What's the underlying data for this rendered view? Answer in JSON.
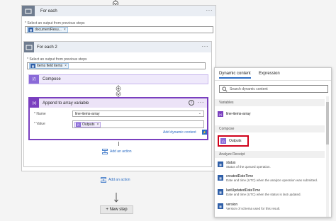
{
  "canvas": {
    "add_action_label": "Add an action",
    "new_step_label": "+ New step"
  },
  "foreach_outer": {
    "title": "For each",
    "select_label": "* Select an output from previous steps",
    "token": "documentResu..."
  },
  "foreach_inner": {
    "title": "For each 2",
    "select_label": "* Select an output from previous steps",
    "token": "Items field items",
    "add_action_label": "Add an action"
  },
  "compose": {
    "title": "Compose"
  },
  "append_action": {
    "title": "Append to array variable",
    "name_label": "* Name",
    "name_value": "line-items-array",
    "value_label": "* Value",
    "value_token": "Outputs",
    "add_dynamic": "Add dynamic content"
  },
  "dynamic_panel": {
    "tabs": [
      "Dynamic content",
      "Expression"
    ],
    "search_placeholder": "Search dynamic content",
    "sections": {
      "variables": "Variables",
      "compose": "Compose",
      "analyze": "Analyze Receipt"
    },
    "variables_item": "line-items-array",
    "compose_item": "Outputs",
    "analyze_items": [
      {
        "title": "status",
        "desc": "Status of the queued operation."
      },
      {
        "title": "createdDateTime",
        "desc": "Date and time (UTC) when the analyze operation was submitted."
      },
      {
        "title": "lastUpdatedDateTime",
        "desc": "Date and time (UTC) when the status is last updated."
      },
      {
        "title": "version",
        "desc": "Version of schema used for this result."
      }
    ]
  },
  "colors": {
    "foreach_header": "#eaeef4",
    "compose_purple": "#8a6ad8",
    "variable_purple": "#7a3fbf",
    "append_header": "#ece3f7",
    "highlight_red": "#d0021b",
    "link_blue": "#2b6cc4"
  }
}
